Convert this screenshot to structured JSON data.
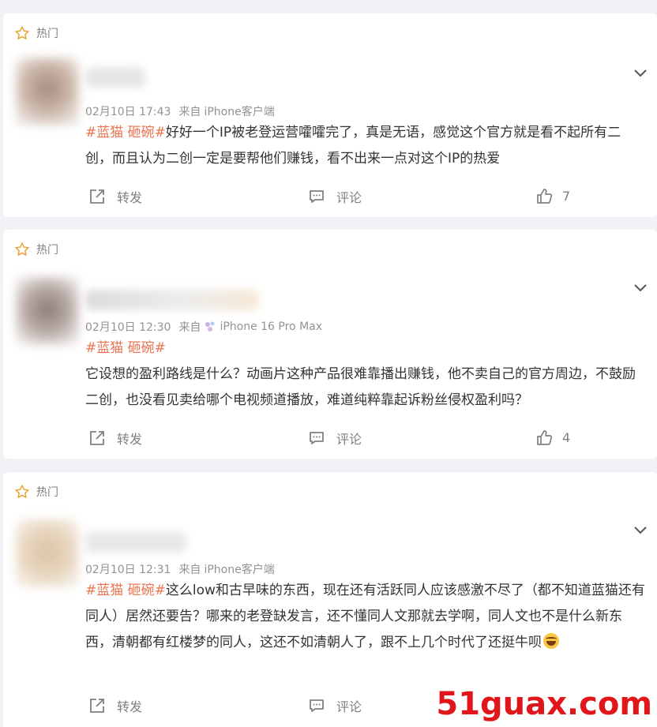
{
  "hot_label": "热门",
  "actions": {
    "repost": "转发",
    "comment": "评论"
  },
  "posts": [
    {
      "time": "02月10日 17:43",
      "from_label": "来自",
      "device": "iPhone客户端",
      "tag": "#蓝猫 砸碗#",
      "text": "好好一个IP被老登运营嚯嚯完了，真是无语，感觉这个官方就是看不起所有二创，而且认为二创一定是要帮他们赚钱，看不出来一点对这个IP的热爱",
      "likes": "7"
    },
    {
      "time": "02月10日 12:30",
      "from_label": "来自",
      "device": "iPhone 16 Pro Max",
      "tag": "#蓝猫 砸碗#",
      "text": "它设想的盈利路线是什么？动画片这种产品很难靠播出赚钱，他不卖自己的官方周边，不鼓励二创，也没看见卖给哪个电视频道播放，难道纯粹靠起诉粉丝侵权盈利吗？",
      "likes": "4"
    },
    {
      "time": "02月10日 12:31",
      "from_label": "来自",
      "device": "iPhone客户端",
      "tag": "#蓝猫 砸碗#",
      "text": "这么low和古早味的东西，现在还有活跃同人应该感激不尽了（都不知道蓝猫还有同人）居然还要告？哪来的老登缺发言，还不懂同人文那就去学啊，同人文也不是什么新东西，清朝都有红楼梦的同人，这还不如清朝人了，跟不上几个时代了还挺牛呗",
      "likes": ""
    }
  ],
  "watermark": "51guax.com",
  "colors": {
    "tag": "#eb7350",
    "background": "#f1f2f5",
    "watermark": "#e0161b"
  }
}
